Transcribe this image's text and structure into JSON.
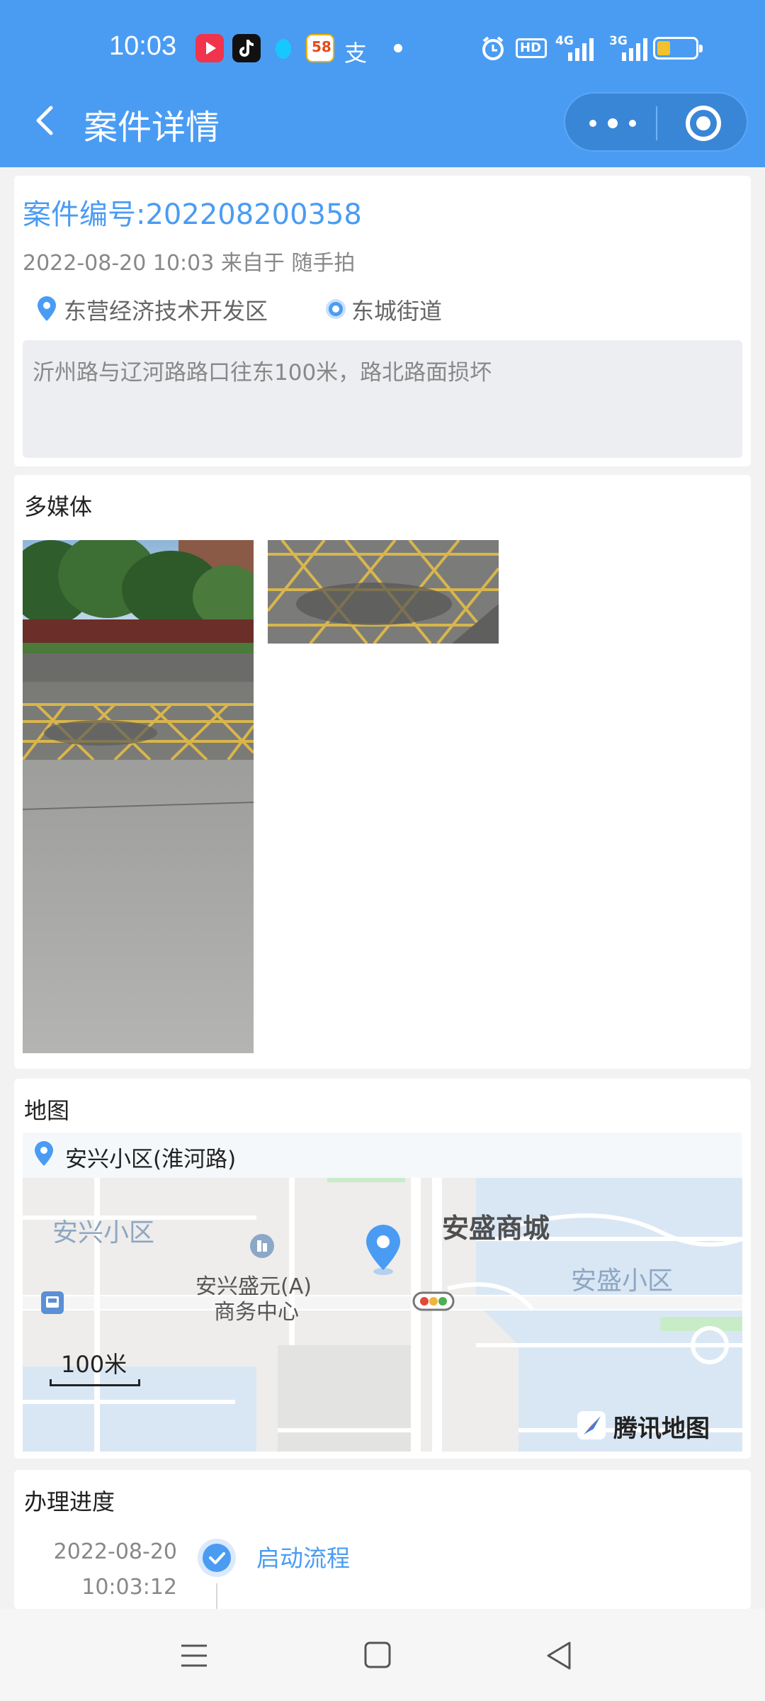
{
  "status_bar": {
    "time": "10:03",
    "app_icons": [
      "video-app-icon",
      "tiktok-icon",
      "qq-icon",
      "58-app-icon",
      "alipay-icon"
    ],
    "app58_label": "58",
    "alipay_glyph": "支",
    "hd_label": "HD",
    "network1": "4G",
    "network2": "3G",
    "battery_level": 0.35
  },
  "header": {
    "title": "案件详情"
  },
  "case": {
    "number_label": "案件编号:202208200358",
    "meta": "2022-08-20 10:03 来自于 随手拍",
    "district": "东营经济技术开发区",
    "street": "东城街道",
    "description": "沂州路与辽河路路口往东100米，路北路面损坏"
  },
  "media": {
    "title": "多媒体",
    "photos": [
      "road-damage-photo-1",
      "road-damage-photo-2"
    ]
  },
  "map": {
    "title": "地图",
    "location": "安兴小区(淮河路)",
    "labels": {
      "anxing": "安兴小区",
      "ansheng_mall": "安盛商城",
      "ansheng_community": "安盛小区",
      "business_center_line1": "安兴盛元(A)",
      "business_center_line2": "商务中心",
      "scale": "100米",
      "brand": "腾讯地图"
    }
  },
  "progress": {
    "title": "办理进度",
    "items": [
      {
        "date": "2022-08-20",
        "time": "10:03:12",
        "step": "启动流程"
      }
    ]
  },
  "colors": {
    "primary": "#4a9cf3",
    "header_bg": "#4a9cf3",
    "page_bg": "#f2f2f2",
    "desc_bg": "#eceef1"
  }
}
